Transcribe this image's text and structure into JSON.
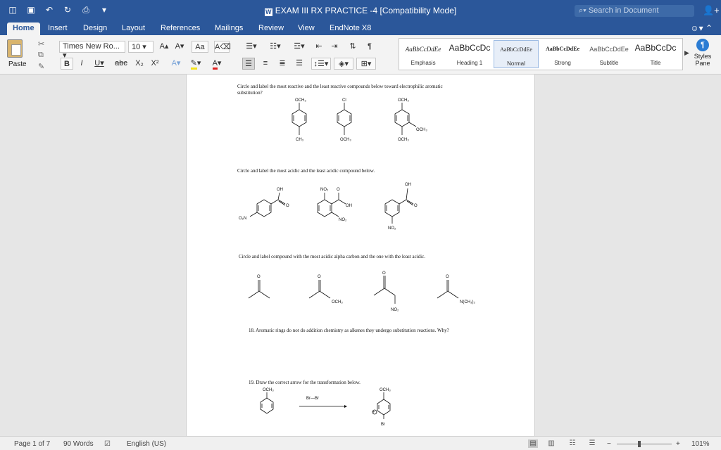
{
  "titlebar": {
    "document_title": "EXAM III RX PRACTICE -4 [Compatibility Mode]",
    "search_placeholder": "Search in Document"
  },
  "tabs": [
    "Home",
    "Insert",
    "Design",
    "Layout",
    "References",
    "Mailings",
    "Review",
    "View",
    "EndNote X8"
  ],
  "ribbon": {
    "paste_label": "Paste",
    "font_name": "Times New Ro...",
    "font_size": "10",
    "styles": [
      {
        "sample": "AaBbCcDdEe",
        "name": "Emphasis"
      },
      {
        "sample": "AaBbCcDc",
        "name": "Heading 1"
      },
      {
        "sample": "AaBbCcDdEe",
        "name": "Normal"
      },
      {
        "sample": "AaBbCcDdEe",
        "name": "Strong"
      },
      {
        "sample": "AaBbCcDdEe",
        "name": "Subtitle"
      },
      {
        "sample": "AaBbCcDc",
        "name": "Title"
      }
    ],
    "styles_pane": "Styles Pane"
  },
  "document": {
    "q1_line1": "Circle and label the most reactive and the least reactive compounds below toward electrophilic aromatic",
    "q1_line2": "substitution?",
    "q2": "Circle and label the most acidic and the least acidic compound below.",
    "q3": "Circle and label compound with the most acidic alpha carbon and the one with the least acidic.",
    "q18": "18.  Aromatic rings do not do addition chemistry as alkenes they undergo substitution reactions.  Why?",
    "q19": "19.  Draw the correct arrow for the transformation below.",
    "labels": {
      "och3": "OCH₃",
      "cl": "Cl",
      "ch3": "CH₃",
      "oh": "OH",
      "no2": "NO₂",
      "o2n": "O₂N",
      "o": "O",
      "n_ch3_2": "N(CH₃)₂",
      "br_br": "Br—Br",
      "br": "Br",
      "plus": "+"
    }
  },
  "statusbar": {
    "page": "Page 1 of 7",
    "words": "90 Words",
    "language": "English (US)",
    "zoom": "101%"
  }
}
